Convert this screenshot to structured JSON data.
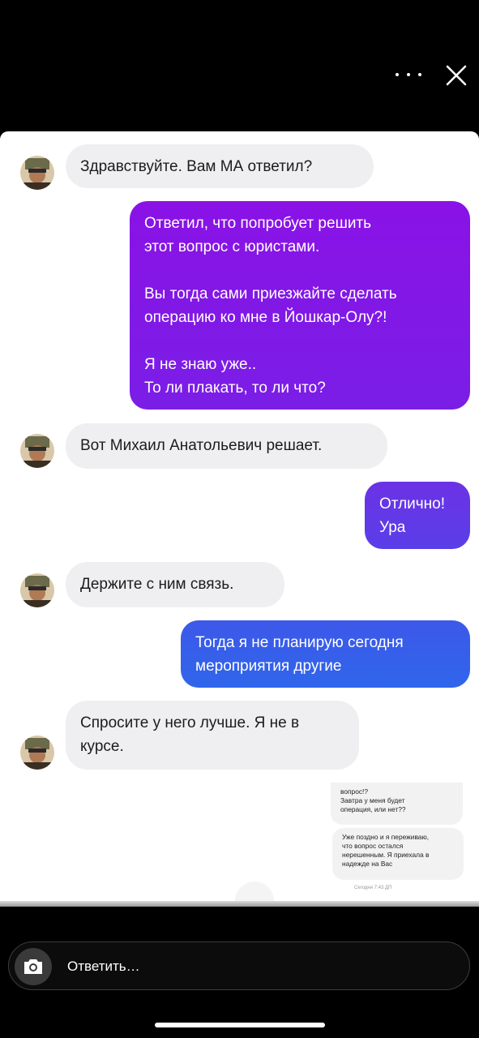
{
  "story_header": {
    "more_icon": "more-dots-icon",
    "close_icon": "close-icon"
  },
  "chat": {
    "messages": [
      {
        "type": "received",
        "text": "Здравствуйте. Вам МА ответил?"
      },
      {
        "type": "sent",
        "text": "Ответил, что попробует решить\nэтот вопрос  с юристами.\n\nВы тогда сами приезжайте сделать\nоперацию ко мне в Йошкар-Олу?!\n\nЯ не знаю уже..\nТо ли плакать, то ли что?"
      },
      {
        "type": "received",
        "text": "Вот Михаил Анатольевич решает."
      },
      {
        "type": "sent",
        "text": "Отлично!\nУра"
      },
      {
        "type": "received",
        "text": "Держите с ним связь."
      },
      {
        "type": "sent",
        "text": "Тогда я не планирую сегодня\nмероприятия другие"
      },
      {
        "type": "received",
        "text": "Спросите у него лучше. Я не в\nкурсе."
      }
    ],
    "embedded_screenshot": {
      "msg1": "вопрос!?\nЗавтра у меня будет\nоперация, или нет??",
      "msg2": "Уже поздно и я переживаю,\nчто вопрос остался\nнерешенным. Я приехала в\nнадежде на Вас",
      "time": "Сегодня 7:43 ДП"
    }
  },
  "colors": {
    "sent_gradient": [
      "#8a12e6",
      "#2f66eb"
    ],
    "received_bg": "#efeff1"
  },
  "reply": {
    "placeholder": "Ответить…",
    "camera_icon": "camera-icon"
  }
}
